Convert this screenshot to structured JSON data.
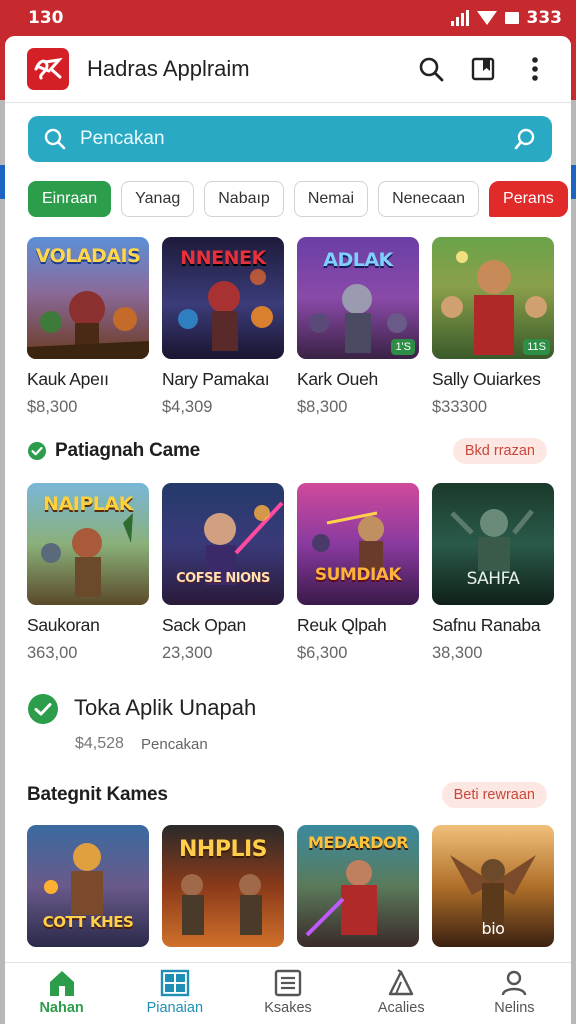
{
  "status_bar": {
    "time": "130",
    "battery": "333"
  },
  "app": {
    "title": "Hadras Applraim"
  },
  "search": {
    "placeholder": "Pencakan"
  },
  "chips": [
    "Einraan",
    "Yanag",
    "Nabaıp",
    "Nemai",
    "Nenecaan",
    "Perans"
  ],
  "row1": [
    {
      "name": "Kauk Apeıı",
      "price": "$8,300",
      "art_title": "VOLADAIS"
    },
    {
      "name": "Nary Pamakaı",
      "price": "$4,309",
      "art_title": "NNENEK"
    },
    {
      "name": "Kark Oueh",
      "price": "$8,300",
      "art_title": "ADLAK",
      "badge": "1'S"
    },
    {
      "name": "Sally Ouiarkes",
      "price": "$33300",
      "badge": "11S"
    }
  ],
  "section1": {
    "title": "Patiagnah Came",
    "pill": "Bkd rrazan"
  },
  "row2": [
    {
      "name": "Saukoran",
      "price": "363,00",
      "art_title": "NAIPLAK"
    },
    {
      "name": "Sack Opan",
      "price": "23,300",
      "art_title": "COFSE NIONS"
    },
    {
      "name": "Reuk Qlpah",
      "price": "$6,300",
      "art_title": "SUMDIAK"
    },
    {
      "name": "Safnu Ranaba",
      "price": "38,300",
      "art_title": "SAHFA"
    }
  ],
  "promo": {
    "title": "Toka Aplik Unapah",
    "price": "$4,528",
    "subtitle": "Pencakan"
  },
  "section2": {
    "title": "Bategnit Kames",
    "pill": "Beti rewraan"
  },
  "row3": [
    {
      "art_title": "COTT KHES"
    },
    {
      "art_title": "NHPLIS"
    },
    {
      "art_title": "MEDARDOR"
    },
    {
      "art_title": "bio"
    }
  ],
  "bottom_nav": [
    "Nahan",
    "Pianaian",
    "Ksakes",
    "Acalies",
    "Nelins"
  ],
  "colors": {
    "status_red": "#c62a2f",
    "search_teal": "#2aa9c4",
    "accent_green": "#2c9d4b",
    "chip_red": "#e12a2a"
  }
}
